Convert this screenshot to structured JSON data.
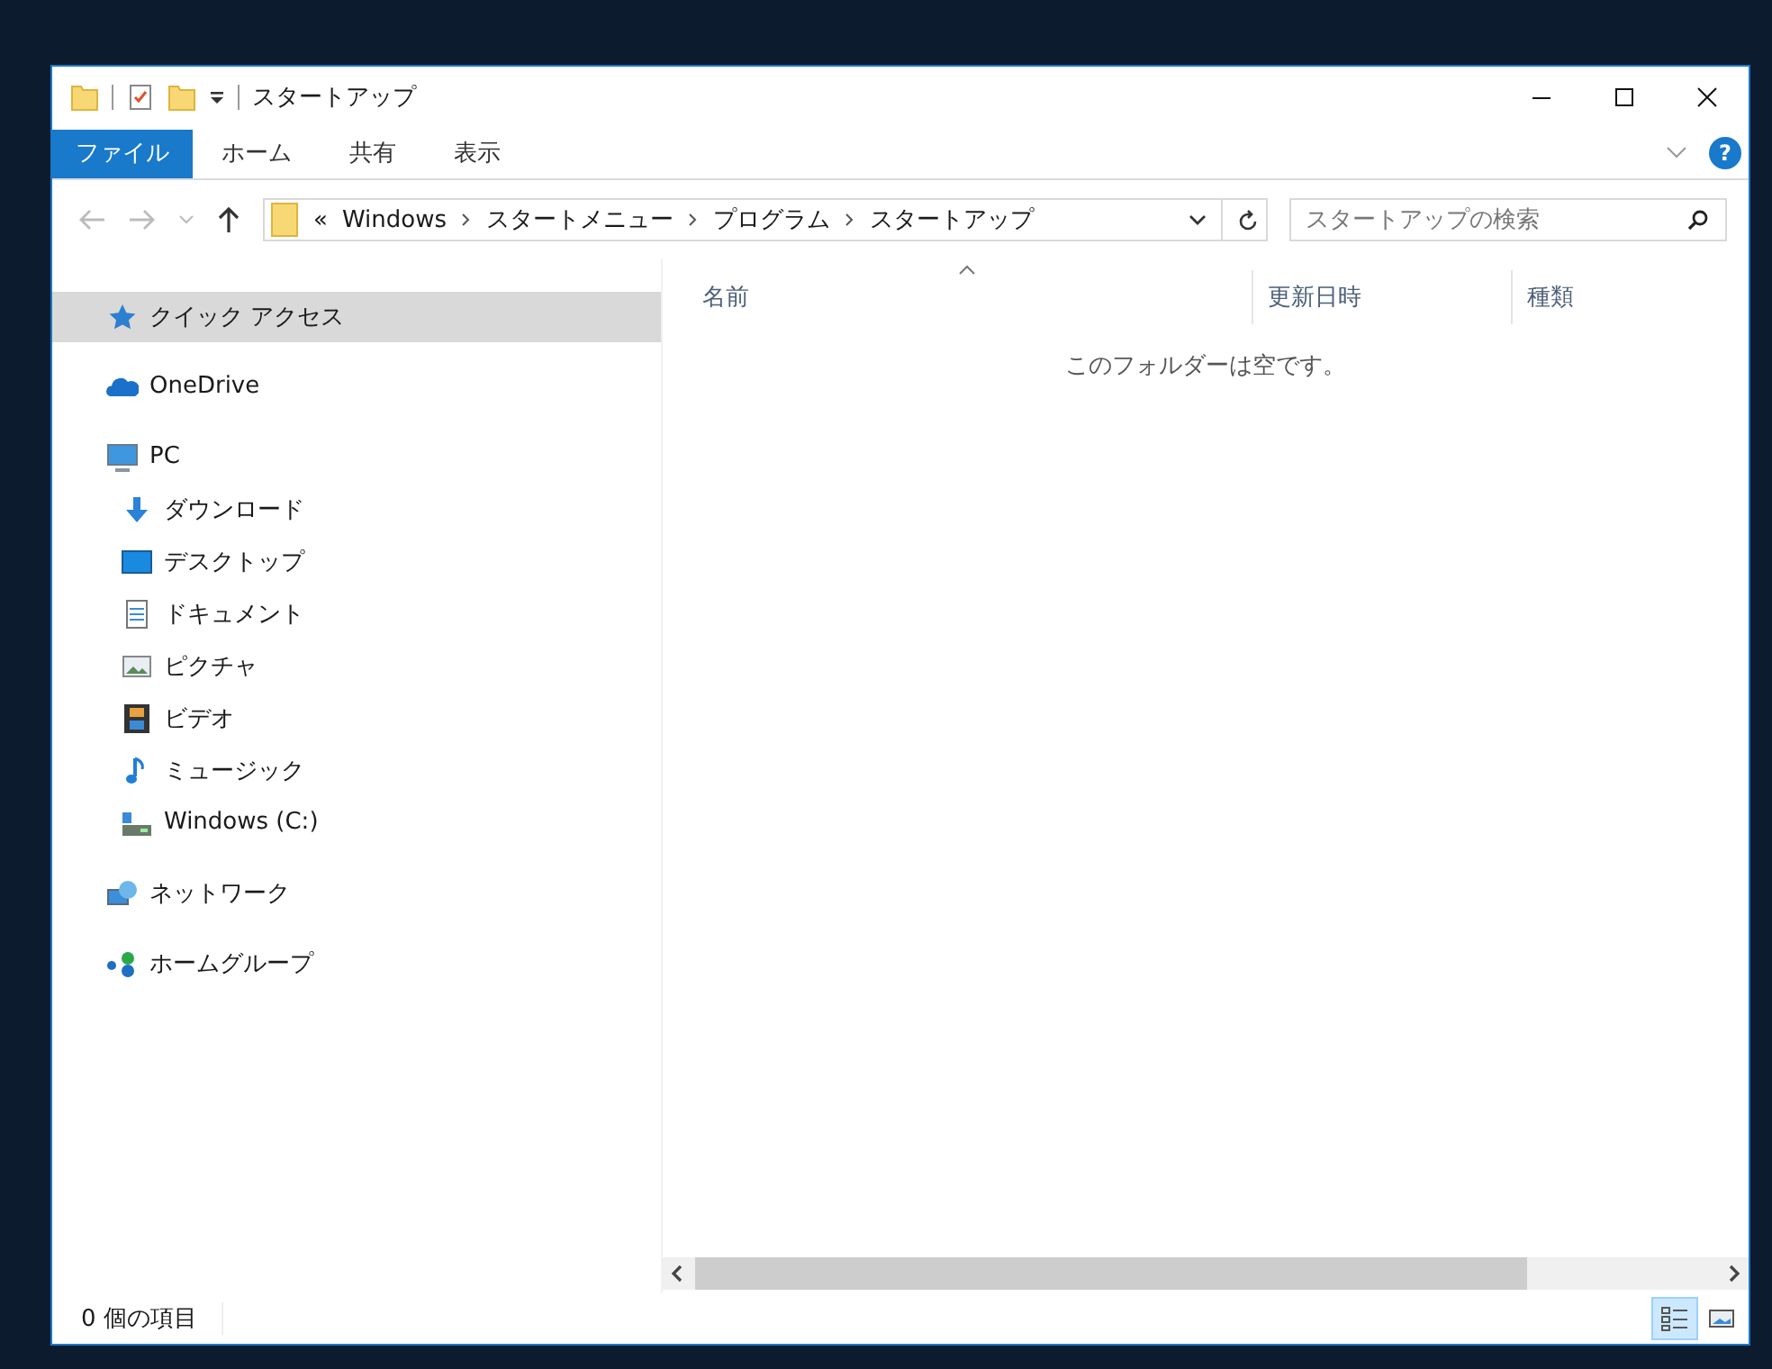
{
  "window": {
    "title": "スタートアップ"
  },
  "ribbon": {
    "tabs": [
      {
        "label": "ファイル",
        "kind": "file",
        "selected": false
      },
      {
        "label": "ホーム",
        "kind": "tab",
        "selected": false
      },
      {
        "label": "共有",
        "kind": "tab",
        "selected": false
      },
      {
        "label": "表示",
        "kind": "tab",
        "selected": false
      }
    ],
    "help": "?"
  },
  "address": {
    "overflow": "«",
    "path": [
      "Windows",
      "スタートメニュー",
      "プログラム",
      "スタートアップ"
    ]
  },
  "search": {
    "placeholder": "スタートアップの検索"
  },
  "sidebar": {
    "items": [
      {
        "label": "クイック アクセス",
        "kind": "star",
        "selected": true
      },
      {
        "label": "OneDrive",
        "kind": "cloud",
        "selected": false
      },
      {
        "label": "PC",
        "kind": "pc",
        "selected": false,
        "children": [
          {
            "label": "ダウンロード",
            "kind": "download",
            "selected": false
          },
          {
            "label": "デスクトップ",
            "kind": "desktop",
            "selected": false
          },
          {
            "label": "ドキュメント",
            "kind": "document",
            "selected": false
          },
          {
            "label": "ピクチャ",
            "kind": "picture",
            "selected": false
          },
          {
            "label": "ビデオ",
            "kind": "video",
            "selected": false
          },
          {
            "label": "ミュージック",
            "kind": "music",
            "selected": false
          },
          {
            "label": "Windows (C:)",
            "kind": "drive",
            "selected": false
          }
        ]
      },
      {
        "label": "ネットワーク",
        "kind": "network",
        "selected": false
      },
      {
        "label": "ホームグループ",
        "kind": "homegroup",
        "selected": false
      }
    ]
  },
  "table": {
    "columns": [
      {
        "label": "名前",
        "sorted": true
      },
      {
        "label": "更新日時"
      },
      {
        "label": "種類"
      }
    ],
    "empty_message": "このフォルダーは空です。"
  },
  "status_bar": {
    "count": "0 個の項目",
    "views": [
      {
        "kind": "details",
        "selected": true
      },
      {
        "kind": "large",
        "selected": false
      }
    ]
  }
}
